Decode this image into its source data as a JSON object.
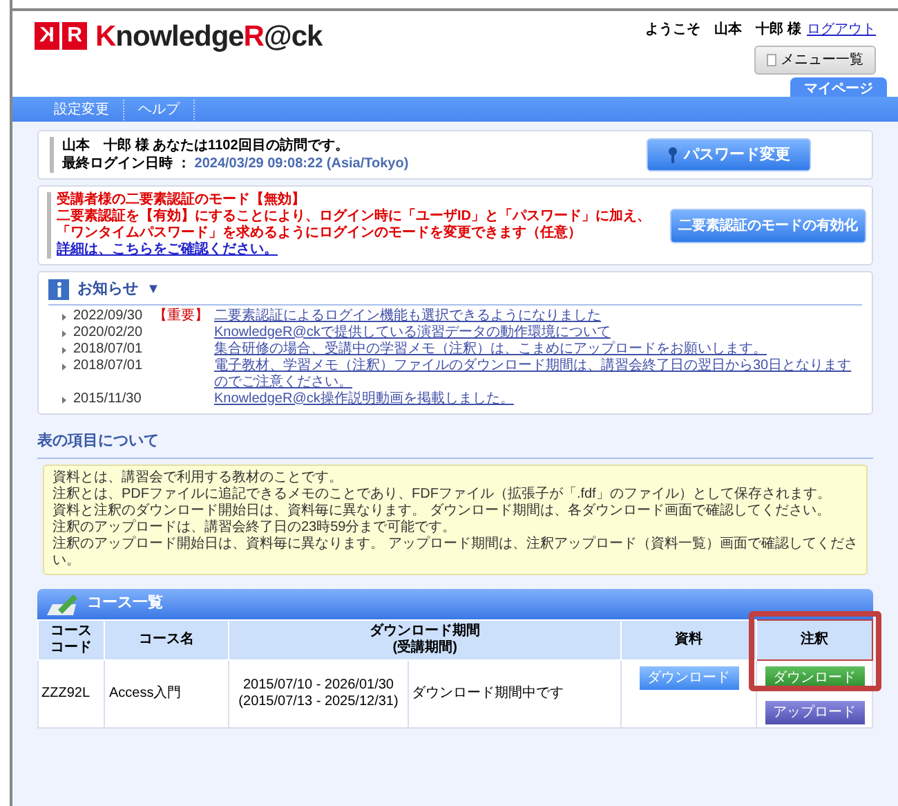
{
  "logo": {
    "mark": [
      {
        "letter": "K",
        "mirrored": true
      },
      {
        "letter": "R",
        "mirrored": false
      }
    ],
    "name": [
      {
        "text": "K",
        "accent": true
      },
      {
        "text": "nowledge",
        "accent": false
      },
      {
        "text": "R",
        "accent": true
      },
      {
        "text": "@ck",
        "accent": false
      }
    ]
  },
  "user": {
    "welcome": "ようこそ　山本　十郎 様",
    "logout": "ログアウト",
    "menu_button": "メニュー一覧"
  },
  "tabs": [
    {
      "label": "マイページ",
      "selected": true
    }
  ],
  "nav": [
    "設定変更",
    "ヘルプ"
  ],
  "visit": {
    "message": "山本　十郎 様 あなたは1102回目の訪問です。",
    "last_login_label": "最終ログイン日時 ：",
    "last_login_value": "2024/03/29 09:08:22 (Asia/Tokyo)",
    "button": "パスワード変更"
  },
  "two_factor": {
    "lines": [
      "受講者様の二要素認証のモード【無効】",
      "二要素認証を【有効】にすることにより、ログイン時に「ユーザID」と「パスワード」に加え、",
      "「ワンタイムパスワード」を求めるようにログインのモードを変更できます（任意）"
    ],
    "link": "詳細は、こちらをご確認ください。",
    "button": "二要素認証のモードの有効化"
  },
  "notices": {
    "title": "お知らせ",
    "toggle": "▼",
    "expanded": true,
    "items": [
      {
        "date": "2022/09/30",
        "tag": "【重要】",
        "text": "二要素認証によるログイン機能も選択できるようになりました"
      },
      {
        "date": "2020/02/20",
        "text": "KnowledgeR@ckで提供している演習データの動作環境について"
      },
      {
        "date": "2018/07/01",
        "text": "集合研修の場合、受講中の学習メモ（注釈）は、こまめにアップロードをお願いします。"
      },
      {
        "date": "2018/07/01",
        "text": "電子教材、学習メモ（注釈）ファイルのダウンロード期間は、講習会終了日の翌日から30日となりますのでご注意ください。"
      },
      {
        "date": "2015/11/30",
        "text": "KnowledgeR@ck操作説明動画を掲載しました。"
      }
    ]
  },
  "about": {
    "heading": "表の項目について",
    "lines": [
      "資料とは、講習会で利用する教材のことです。",
      "注釈とは、PDFファイルに追記できるメモのことであり、FDFファイル（拡張子が「.fdf」のファイル）として保存されます。",
      "資料と注釈のダウンロード開始日は、資料毎に異なります。 ダウンロード期間は、各ダウンロード画面で確認してください。",
      "注釈のアップロードは、講習会終了日の23時59分まで可能です。",
      "注釈のアップロード開始日は、資料毎に異なります。 アップロード期間は、注釈アップロード（資料一覧）画面で確認してください。"
    ]
  },
  "courses": {
    "title": "コース一覧",
    "columns": [
      {
        "label": "コースコード",
        "highlighted": false
      },
      {
        "label": "コース名",
        "highlighted": false
      },
      {
        "label": "ダウンロード期間\n(受講期間)",
        "highlighted": false
      },
      {
        "label": "資料",
        "highlighted": false
      },
      {
        "label": "注釈",
        "highlighted": true
      }
    ],
    "rows": [
      {
        "code": "ZZZ92L",
        "name": "Access入門",
        "period": "2015/07/10 - 2026/01/30",
        "attendance": "(2015/07/13 - 2025/12/31)",
        "status": "ダウンロード期間中です",
        "material_button": "ダウンロード",
        "note_download": "ダウンロード",
        "note_upload": "アップロード"
      }
    ]
  }
}
